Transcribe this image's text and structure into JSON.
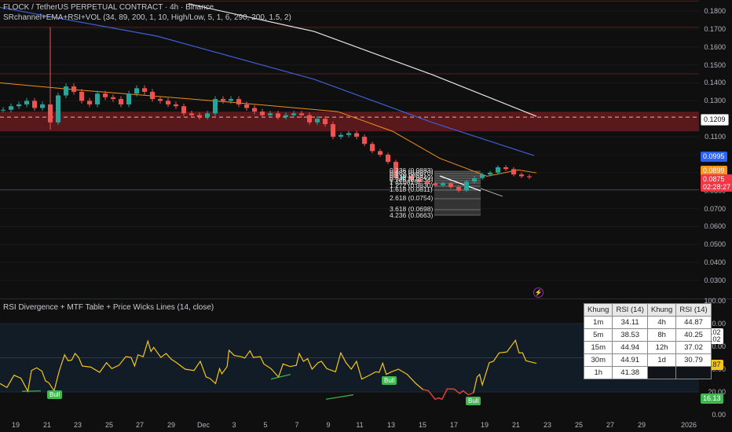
{
  "header": {
    "symbol_title": "FLOCK / TetherUS PERPETUAL CONTRACT · 4h · Binance",
    "indicator": "SRchannel+EMA+RSI+VOL (34, 89, 200, 1, 10, High/Low, 5, 1, 6, 290, 200, 1.5, 2)"
  },
  "price_axis": {
    "ticks": [
      "0.1800",
      "0.1700",
      "0.1600",
      "0.1500",
      "0.1400",
      "0.1300",
      "0.1100",
      "0.0800",
      "0.0700",
      "0.0600",
      "0.0500",
      "0.0400",
      "0.0300"
    ],
    "tags": {
      "sr_level": "0.1209",
      "ema89": "0.0995",
      "ema34": "0.0899",
      "last_price": "0.0875",
      "countdown": "02:28:27"
    }
  },
  "colors": {
    "up": "#26a69a",
    "down": "#ef5350",
    "ema200": "#e6e6e6",
    "ema89": "#3d5fd6",
    "ema34": "#f0901e",
    "rsi": "#f5c518",
    "zone": "#6b1a1e",
    "bull": "#3fb94f"
  },
  "fib_labels": [
    "0.236 (0.0883)",
    "0.382 (0.0870)",
    "0.5 (0.0859)",
    "0.618 (0.0849)",
    "0.786 (0.0834)",
    "1 (0.0815)",
    "1.272 (0.0830)",
    "1.618 (0.0811)",
    "2.618 (0.0754)",
    "3.618 (0.0698)",
    "4.236 (0.0663)"
  ],
  "rsi_panel": {
    "title": "RSI Divergence + MTF Table + Price Wicks Lines (14, close)",
    "axis": [
      "100.00",
      "80.00",
      "60.00",
      "40.00",
      "20.00",
      "0.00"
    ],
    "tags": {
      "upper": "65.02",
      "upper2": "65.02",
      "current": "44.87",
      "lower": "16.13"
    },
    "bull_label": "Bull",
    "table": {
      "headers": [
        "Khung",
        "RSI (14)",
        "Khung",
        "RSI (14)"
      ],
      "rows": [
        [
          "1m",
          "34.11",
          "4h",
          "44.87"
        ],
        [
          "5m",
          "38.53",
          "8h",
          "40.25"
        ],
        [
          "15m",
          "44.94",
          "12h",
          "37.02"
        ],
        [
          "30m",
          "44.91",
          "1d",
          "30.79"
        ],
        [
          "1h",
          "41.38",
          "",
          ""
        ]
      ]
    }
  },
  "time_axis": [
    "19",
    "21",
    "23",
    "25",
    "27",
    "29",
    "Dec",
    "3",
    "5",
    "7",
    "9",
    "11",
    "13",
    "15",
    "17",
    "19",
    "21",
    "23",
    "25",
    "27",
    "29",
    "2026"
  ],
  "chart_data": {
    "type": "candlestick",
    "start": "Nov 18",
    "step_days": 0.5,
    "closes": [
      0.125,
      0.127,
      0.128,
      0.13,
      0.126,
      0.128,
      0.118,
      0.133,
      0.138,
      0.135,
      0.13,
      0.128,
      0.134,
      0.132,
      0.131,
      0.128,
      0.134,
      0.137,
      0.135,
      0.131,
      0.13,
      0.128,
      0.127,
      0.123,
      0.122,
      0.121,
      0.123,
      0.131,
      0.13,
      0.131,
      0.128,
      0.126,
      0.124,
      0.122,
      0.123,
      0.121,
      0.122,
      0.123,
      0.122,
      0.118,
      0.12,
      0.117,
      0.11,
      0.111,
      0.112,
      0.11,
      0.106,
      0.102,
      0.1,
      0.096,
      0.087,
      0.088,
      0.086,
      0.085,
      0.084,
      0.083,
      0.084,
      0.082,
      0.08,
      0.085,
      0.087,
      0.089,
      0.09,
      0.093,
      0.092,
      0.089,
      0.088,
      0.0875
    ],
    "spike": {
      "t": 3,
      "high": 0.171,
      "low": 0.114
    },
    "ema200": [
      [
        12,
        0.184
      ],
      [
        20,
        0.1686
      ],
      [
        27.5,
        0.1446
      ],
      [
        34.15,
        0.1214
      ]
    ],
    "ema89": [
      [
        0,
        0.182
      ],
      [
        10,
        0.166
      ],
      [
        20,
        0.142
      ],
      [
        27.5,
        0.118
      ],
      [
        34,
        0.0995
      ]
    ],
    "ema34": [
      [
        0,
        0.14
      ],
      [
        5,
        0.136
      ],
      [
        15,
        0.129
      ],
      [
        21.5,
        0.124
      ],
      [
        25,
        0.113
      ],
      [
        28,
        0.098
      ],
      [
        31,
        0.088
      ],
      [
        33,
        0.0915
      ],
      [
        34.15,
        0.0899
      ]
    ],
    "sr_zone": [
      0.113,
      0.124
    ],
    "sr_level": 0.1209,
    "resistance_lines": [
      0.1855,
      0.171,
      0.145
    ],
    "support_line": 0.0805,
    "rsi": [
      [
        0,
        27.4
      ],
      [
        0.33,
        23.9
      ],
      [
        0.67,
        34.7
      ],
      [
        1,
        32
      ],
      [
        1.33,
        20.5
      ],
      [
        1.5,
        38.8
      ],
      [
        1.75,
        41.2
      ],
      [
        2,
        38.2
      ],
      [
        2.17,
        29.7
      ],
      [
        2.33,
        28
      ],
      [
        2.58,
        20.9
      ],
      [
        2.83,
        38.8
      ],
      [
        3.08,
        52.6
      ],
      [
        3.25,
        47.4
      ],
      [
        3.42,
        48
      ],
      [
        3.58,
        53.8
      ],
      [
        3.75,
        50.3
      ],
      [
        3.92,
        42.8
      ],
      [
        4.33,
        41.8
      ],
      [
        4.75,
        37.2
      ],
      [
        5.08,
        45.7
      ],
      [
        5.33,
        40.5
      ],
      [
        5.67,
        43.4
      ],
      [
        6,
        51
      ],
      [
        6.25,
        50.3
      ],
      [
        6.42,
        42.8
      ],
      [
        6.58,
        52.6
      ],
      [
        6.83,
        51
      ],
      [
        7.05,
        64.6
      ],
      [
        7.2,
        55.6
      ],
      [
        7.33,
        59.1
      ],
      [
        7.67,
        50.3
      ],
      [
        7.92,
        53.8
      ],
      [
        8.17,
        48.7
      ],
      [
        8.42,
        45.7
      ],
      [
        8.83,
        40
      ],
      [
        9.25,
        38.8
      ],
      [
        9.55,
        46.9
      ],
      [
        9.83,
        33.1
      ],
      [
        10,
        32
      ],
      [
        10.28,
        27.4
      ],
      [
        10.47,
        40.5
      ],
      [
        10.58,
        35.9
      ],
      [
        10.83,
        42.3
      ],
      [
        10.92,
        56.6
      ],
      [
        11.17,
        52
      ],
      [
        11.5,
        51
      ],
      [
        11.67,
        49.7
      ],
      [
        11.92,
        56.1
      ],
      [
        12.08,
        50.3
      ],
      [
        12.42,
        51
      ],
      [
        12.58,
        44.6
      ],
      [
        12.92,
        40.5
      ],
      [
        13.28,
        33.1
      ],
      [
        13.5,
        44.6
      ],
      [
        13.83,
        42.3
      ],
      [
        14.13,
        43.4
      ],
      [
        14.27,
        53.8
      ],
      [
        14.47,
        46.9
      ],
      [
        14.67,
        49.2
      ],
      [
        14.88,
        40
      ],
      [
        15.17,
        45.7
      ],
      [
        15.33,
        46.9
      ],
      [
        15.58,
        40.5
      ],
      [
        16,
        37.7
      ],
      [
        16.25,
        54.3
      ],
      [
        16.5,
        45.7
      ],
      [
        16.75,
        40
      ],
      [
        17,
        46.9
      ],
      [
        17.25,
        31.3
      ],
      [
        17.58,
        34.3
      ],
      [
        17.92,
        37.7
      ],
      [
        18.08,
        37.2
      ],
      [
        18.25,
        45.3
      ],
      [
        18.42,
        35.4
      ],
      [
        18.67,
        37.7
      ],
      [
        19,
        40
      ],
      [
        19.42,
        35.4
      ],
      [
        19.83,
        27.4
      ],
      [
        20.17,
        22.1
      ],
      [
        20.42,
        21.2
      ],
      [
        20.75,
        13.6
      ],
      [
        20.92,
        14.7
      ],
      [
        21.08,
        13.6
      ],
      [
        21.33,
        22.8
      ],
      [
        21.67,
        22.4
      ],
      [
        21.92,
        18.6
      ],
      [
        22.08,
        21
      ],
      [
        22.33,
        17.5
      ],
      [
        22.58,
        19.3
      ],
      [
        22.75,
        33.1
      ],
      [
        22.87,
        35.4
      ],
      [
        23,
        26.2
      ],
      [
        23.33,
        45.7
      ],
      [
        23.53,
        46.9
      ],
      [
        23.8,
        54.3
      ],
      [
        24.17,
        55.1
      ],
      [
        24.58,
        65.3
      ],
      [
        24.75,
        54.3
      ],
      [
        24.92,
        54.3
      ],
      [
        25.08,
        47.4
      ],
      [
        25.58,
        45.1
      ]
    ]
  }
}
